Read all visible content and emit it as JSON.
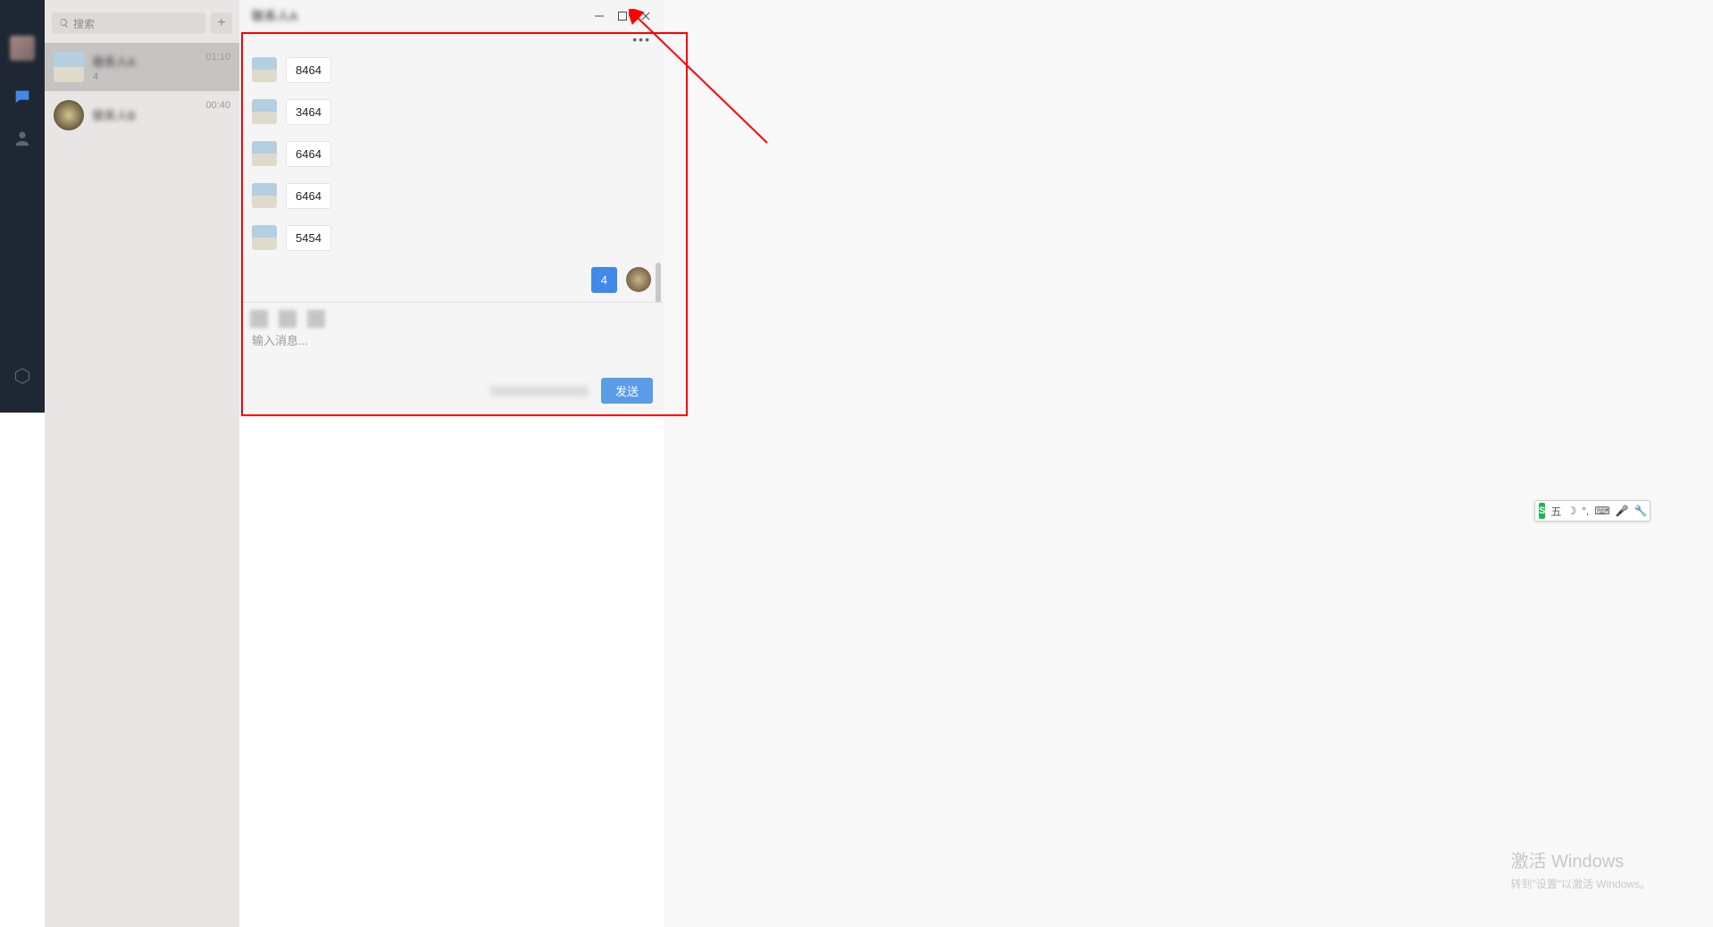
{
  "search": {
    "placeholder": "搜索"
  },
  "conversations": [
    {
      "name": "联系人A",
      "preview": "4",
      "time": "01:10"
    },
    {
      "name": "联系人B",
      "preview": "",
      "time": "00:40"
    }
  ],
  "chat": {
    "title": "联系人A",
    "messages": [
      {
        "dir": "in",
        "text": "8464"
      },
      {
        "dir": "in",
        "text": "3464"
      },
      {
        "dir": "in",
        "text": "6464"
      },
      {
        "dir": "in",
        "text": "6464"
      },
      {
        "dir": "in",
        "text": "5454"
      },
      {
        "dir": "out",
        "text": "4"
      }
    ],
    "input_placeholder": "输入消息...",
    "send_label": "发送"
  },
  "ime": {
    "badge": "S",
    "glyph": "五"
  },
  "watermark": {
    "line1": "激活 Windows",
    "line2": "转到\"设置\"以激活 Windows。"
  }
}
